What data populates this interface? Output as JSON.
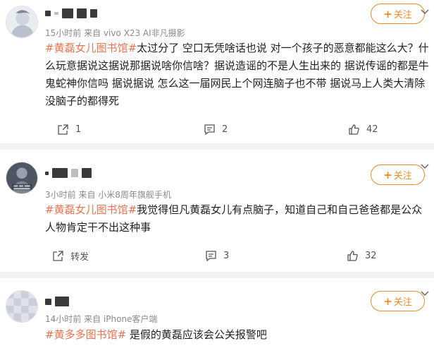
{
  "follow_label": "关注",
  "posts": [
    {
      "meta": "15小时前 来自 vivo X23 AI非凡摄影",
      "tag": "#黄磊女儿图书馆#",
      "text": "太过分了 空口无凭啥话也说 对一个孩子的恶意都能这么大？什么玩意据说这据说那据说啥你信啥？据说造谣的不是人生出来的 据说传谣的都是牛鬼蛇神你信吗 据说据说 怎么这一届网民上个网连脑子也不带 据说马上人类大清除没脑子的都得死",
      "repost": "1",
      "comments": "2",
      "likes": "42"
    },
    {
      "meta": "3小时前 来自 小米8周年旗舰手机",
      "tag": "#黄磊女儿图书馆#",
      "text": "我觉得但凡黄磊女儿有点脑子，知道自己和自己爸爸都是公众人物肯定干不出这种事",
      "repost": "转发",
      "comments": "3",
      "likes": "32"
    },
    {
      "meta": "14小时前 来自 iPhone客户端",
      "tag": "#黄多多图书馆#",
      "text": " 是假的黄磊应该会公关报警吧"
    }
  ]
}
